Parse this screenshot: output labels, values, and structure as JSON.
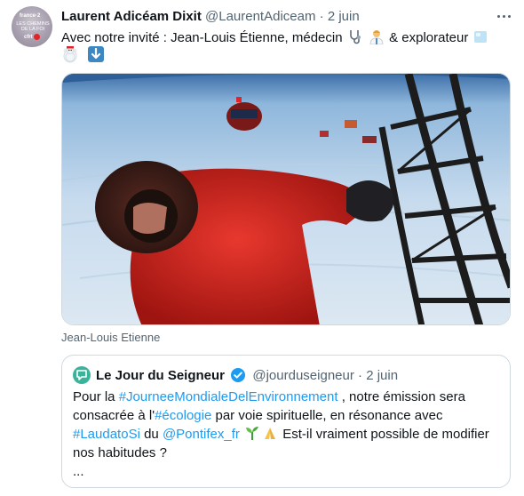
{
  "tweet": {
    "author_name": "Laurent Adicéam Dixit",
    "handle": "@LaurentAdiceam",
    "separator": "·",
    "time": "2 juin",
    "text_part1": "Avec notre invité : Jean-Louis Étienne, médecin",
    "text_part2": "& explorateur",
    "media_caption": "Jean-Louis Etienne"
  },
  "avatar": {
    "channel": "france·2",
    "title": "LES CHEMINS DE LA FOI",
    "logo": "cfrt"
  },
  "quoted": {
    "author_name": "Le Jour du Seigneur",
    "handle": "@jourduseigneur",
    "separator": "·",
    "time": "2 juin",
    "t1": "Pour la ",
    "h1": "#JourneeMondialeDelEnvironnement",
    "t2": " , notre émission sera consacrée à l'",
    "h2": "#écologie",
    "t3": " par voie spirituelle, en résonance avec ",
    "h3": "#LaudatoSi",
    "t4": " du ",
    "h4": "@Pontifex_fr",
    "t5": " Est-il vraiment possible de modifier nos habitudes ?",
    "ellipsis": "..."
  },
  "icons": {
    "emojis": [
      "stethoscope-icon",
      "doctor-icon",
      "ice-cube-icon",
      "polar-bear-icon",
      "snowman-icon",
      "down-arrow-icon",
      "seedling-icon",
      "praying-hands-icon"
    ],
    "more": "more-icon",
    "verified": "verified-icon"
  },
  "colors": {
    "link": "#1d9bf0",
    "muted": "#536471",
    "border": "#cfd9de"
  }
}
